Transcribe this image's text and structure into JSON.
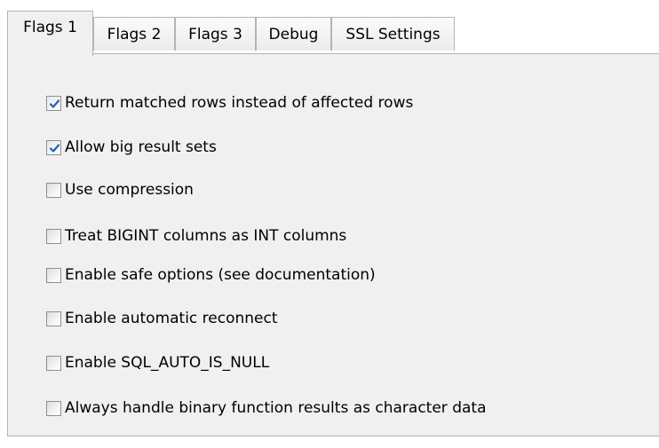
{
  "tabs": [
    {
      "label": "Flags 1",
      "active": true
    },
    {
      "label": "Flags 2",
      "active": false
    },
    {
      "label": "Flags 3",
      "active": false
    },
    {
      "label": "Debug",
      "active": false
    },
    {
      "label": "SSL Settings",
      "active": false
    }
  ],
  "options": [
    {
      "label": "Return matched rows instead of affected rows",
      "checked": true
    },
    {
      "label": "Allow big result sets",
      "checked": true
    },
    {
      "label": "Use compression",
      "checked": false
    },
    {
      "label": "Treat BIGINT columns as INT columns",
      "checked": false
    },
    {
      "label": "Enable safe options (see documentation)",
      "checked": false
    },
    {
      "label": "Enable automatic reconnect",
      "checked": false
    },
    {
      "label": "Enable SQL_AUTO_IS_NULL",
      "checked": false
    },
    {
      "label": "Always handle binary function results as character data",
      "checked": false
    }
  ],
  "colors": {
    "check": "#2a5fa8",
    "panel": "#f0f0f0",
    "border": "#b4b4b4"
  },
  "icons": {
    "check": "checkmark-icon"
  }
}
